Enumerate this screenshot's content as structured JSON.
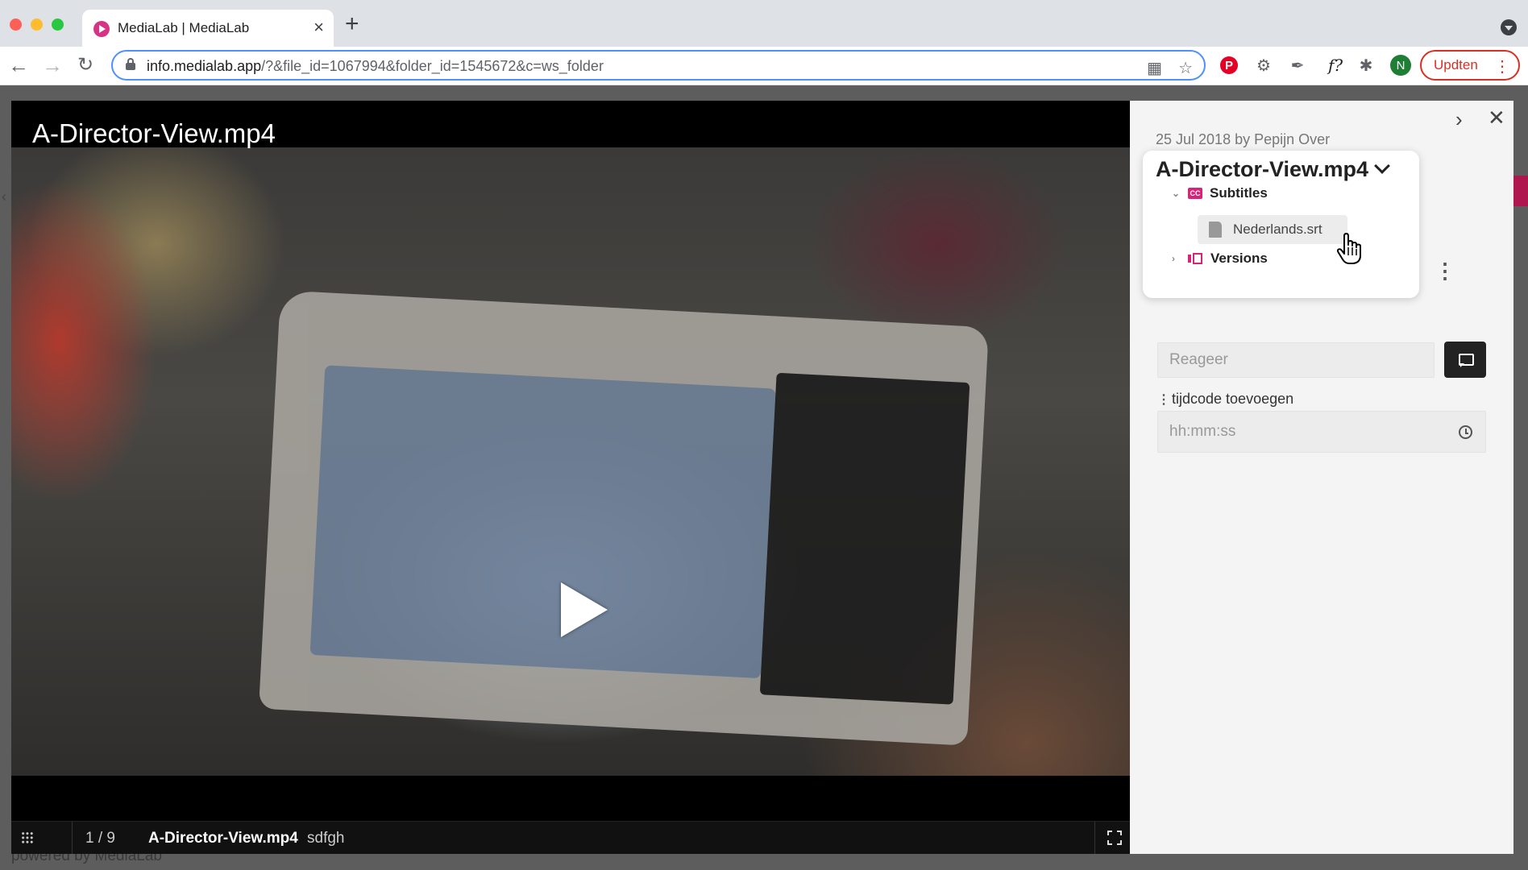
{
  "browser": {
    "tab_title": "MediaLab | MediaLab",
    "tab_close": "×",
    "new_tab": "+",
    "url_host": "info.medialab.app",
    "url_path": "/?&file_id=1067994&folder_id=1545672&c=ws_folder",
    "update_label": "Updten",
    "avatar_letter": "N",
    "ext_fx_label": "f?",
    "pinterest_letter": "P"
  },
  "viewer": {
    "title": "A-Director-View.mp4",
    "counter": "1 / 9",
    "file_name": "A-Director-View.mp4",
    "description": "sdfgh"
  },
  "page": {
    "powered_by": "powered by MediaLab"
  },
  "panel": {
    "date_author": "25 Jul 2018 by Pepijn Over",
    "file_title": "A-Director-View.mp4",
    "subtitles_label": "Subtitles",
    "subtitle_file": "Nederlands.srt",
    "versions_label": "Versions",
    "comment_placeholder": "Reageer",
    "timecode_label": "tijdcode toevoegen",
    "timecode_placeholder": "hh:mm:ss"
  },
  "icons": {
    "favicon": "medialab-play-icon",
    "subtitles": "cc-icon",
    "versions": "versions-icon",
    "send": "comment-send-icon",
    "clock": "clock-icon"
  },
  "colors": {
    "accent": "#d6247a",
    "update": "#d93025",
    "omnibox_focus": "#4d90fe"
  }
}
